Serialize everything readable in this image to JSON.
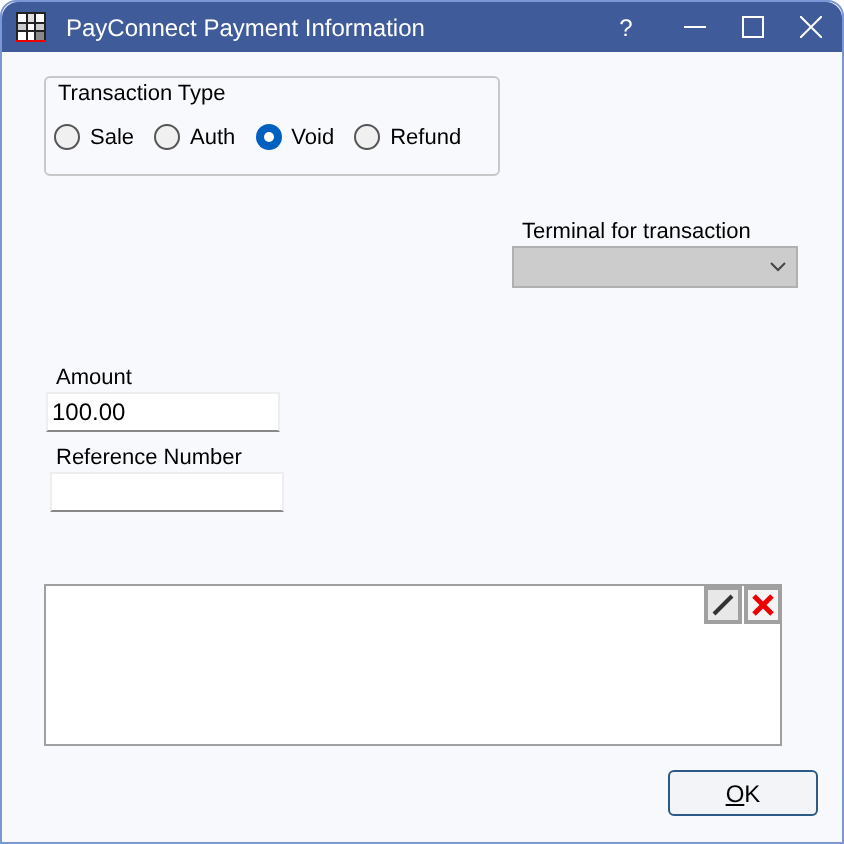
{
  "window": {
    "title": "PayConnect Payment Information",
    "controls": [
      "?"
    ]
  },
  "transaction_type": {
    "label": "Transaction Type",
    "options": [
      {
        "label": "Sale",
        "selected": false
      },
      {
        "label": "Auth",
        "selected": false
      },
      {
        "label": "Void",
        "selected": true
      },
      {
        "label": "Refund",
        "selected": false
      }
    ]
  },
  "terminal": {
    "label": "Terminal for transaction",
    "disabled": true
  },
  "amount": {
    "label": "Amount",
    "value": "100.00"
  },
  "reference_number": {
    "label": "Reference Number"
  },
  "buttons": [
    "OK"
  ]
}
